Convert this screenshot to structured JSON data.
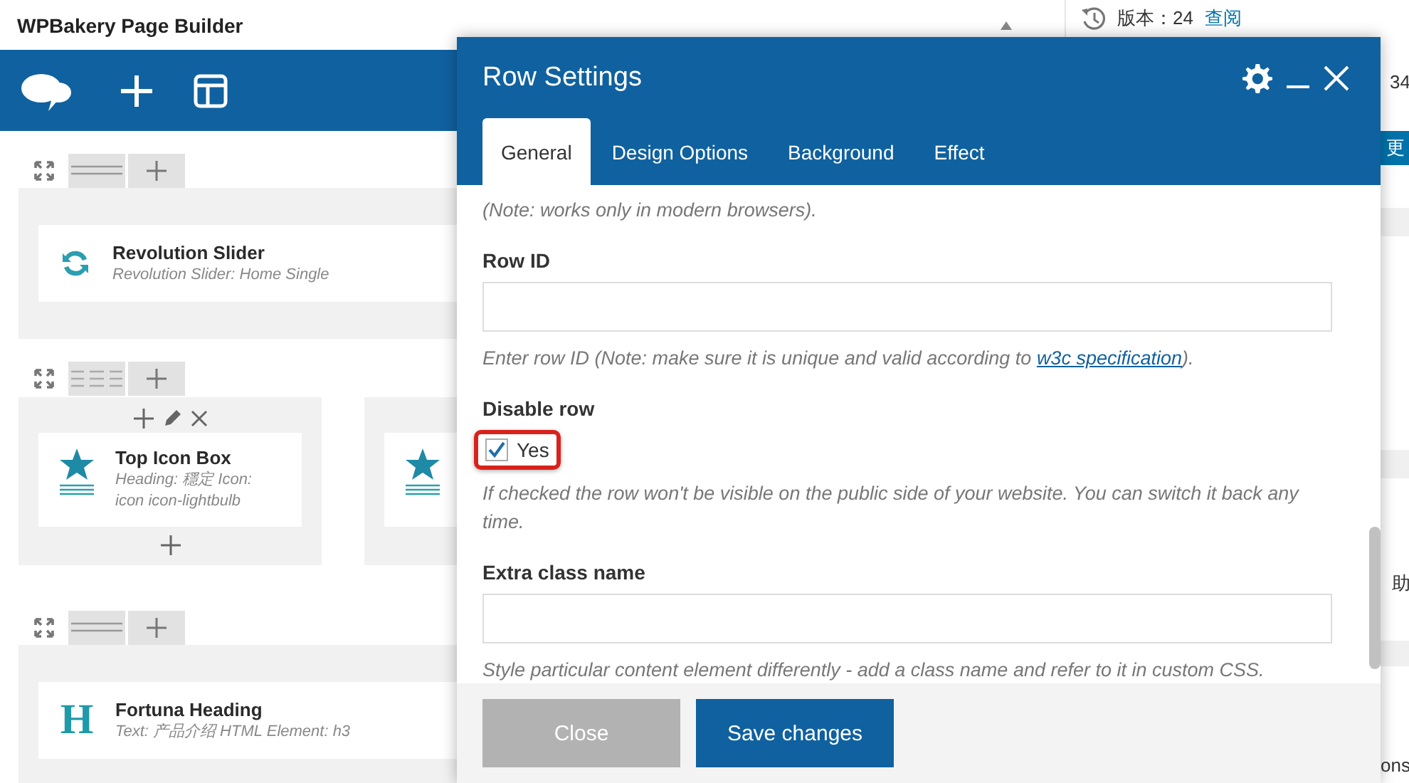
{
  "builder": {
    "title": "WPBakery Page Builder"
  },
  "rows": [
    {
      "kind": "single",
      "columns": [
        {
          "elements": [
            {
              "kind": "slider",
              "title": "Revolution Slider",
              "subtitle": "Revolution Slider: Home Single"
            }
          ]
        }
      ]
    },
    {
      "kind": "thirds",
      "columns": [
        {
          "hovered": true,
          "elements": [
            {
              "kind": "icon_box",
              "title": "Top Icon Box",
              "subtitle": "Heading: 穩定 Icon: icon icon-lightbulb"
            }
          ]
        },
        {
          "elements": [
            {
              "kind": "icon_box"
            }
          ]
        }
      ]
    },
    {
      "kind": "single",
      "columns": [
        {
          "elements": [
            {
              "kind": "heading",
              "icon_text": "H",
              "title": "Fortuna Heading",
              "subtitle": "Text: 产品介绍 HTML Element: h3"
            }
          ]
        }
      ]
    }
  ],
  "sidebar": {
    "version_label": "版本：24",
    "version_link": "查阅",
    "count": "34",
    "button": "更",
    "note": "助",
    "tail": "ons"
  },
  "modal": {
    "title": "Row Settings",
    "tabs": [
      {
        "label": "General",
        "selected": true
      },
      {
        "label": "Design Options",
        "selected": false
      },
      {
        "label": "Background",
        "selected": false
      },
      {
        "label": "Effect",
        "selected": false
      }
    ],
    "note": "(Note: works only in modern browsers).",
    "fields": [
      {
        "kind": "text",
        "label": "Row ID",
        "help": "Enter row ID (Note: make sure it is unique and valid according to ",
        "help_link": "w3c specification",
        "help_after": ")."
      },
      {
        "kind": "checkbox",
        "label": "Disable row",
        "option": "Yes",
        "checked": true,
        "highlighted": true,
        "help": "If checked the row won't be visible on the public side of your website. You can switch it back any time."
      },
      {
        "kind": "text",
        "label": "Extra class name",
        "help": "Style particular content element differently - add a class name and refer to it in custom CSS."
      }
    ],
    "buttons": [
      {
        "label": "Close",
        "kind": "secondary"
      },
      {
        "label": "Save changes",
        "kind": "primary"
      }
    ]
  }
}
